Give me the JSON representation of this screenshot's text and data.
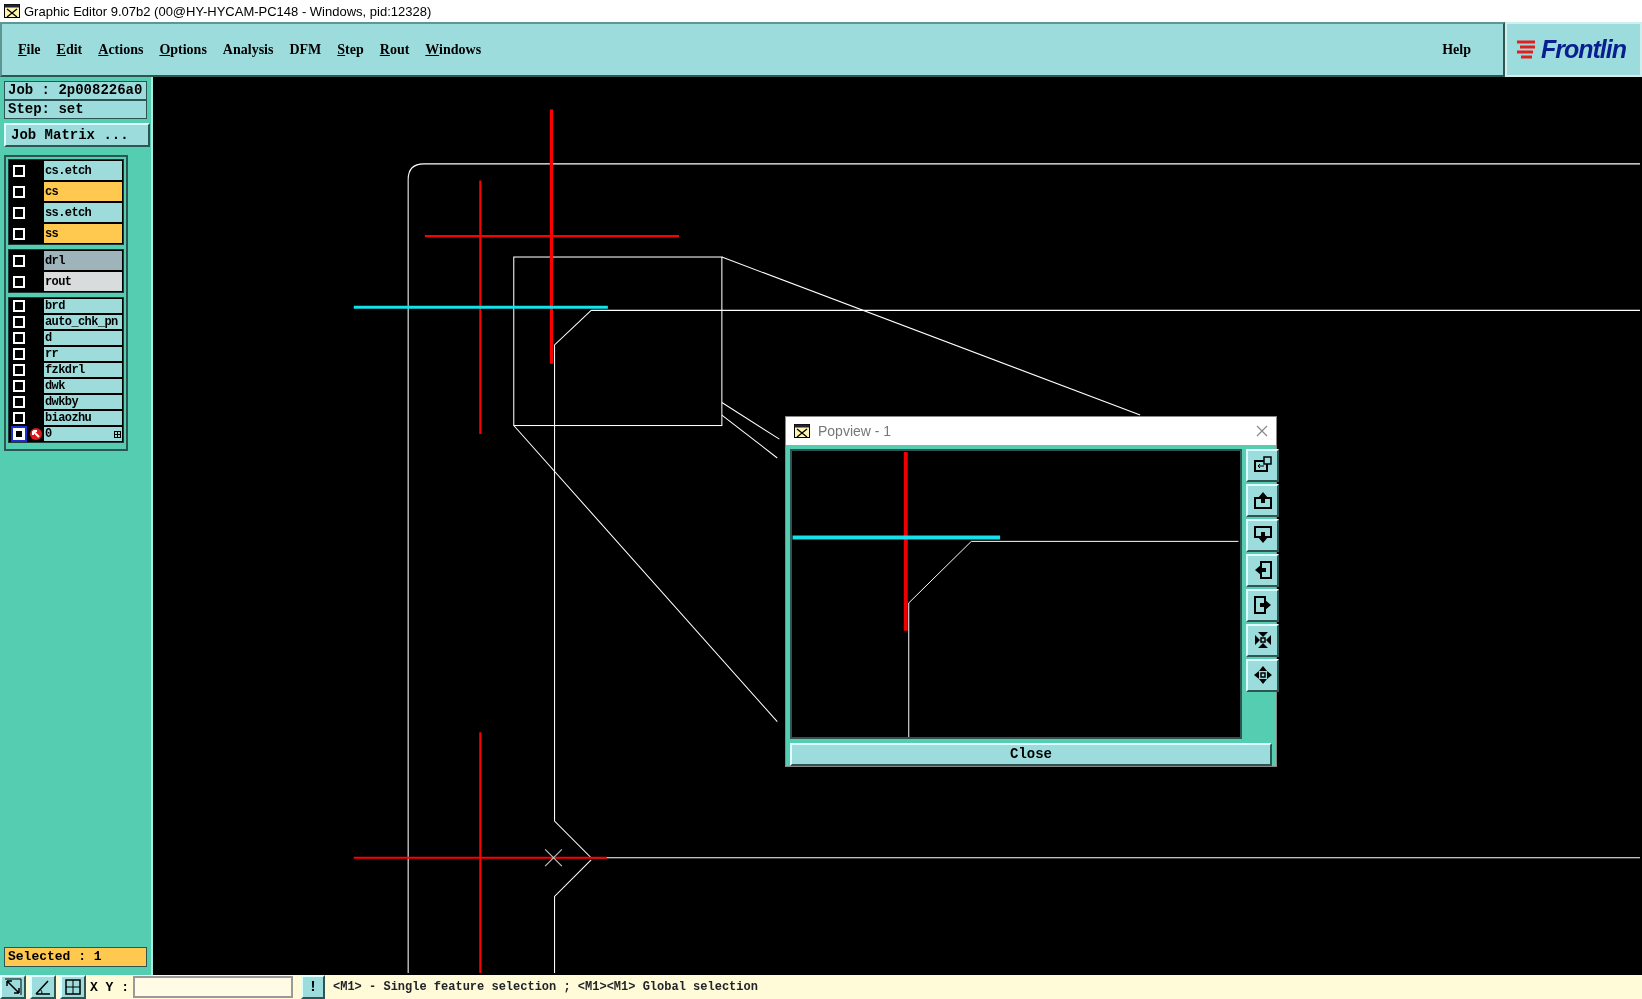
{
  "window": {
    "title": "Graphic Editor 9.07b2 (00@HY-HYCAM-PC148 - Windows, pid:12328)"
  },
  "menu": [
    {
      "label": "File",
      "mnemonic": true
    },
    {
      "label": "Edit",
      "mnemonic": true
    },
    {
      "label": "Actions",
      "mnemonic": true
    },
    {
      "label": "Options",
      "mnemonic": true
    },
    {
      "label": "Analysis",
      "mnemonic": false
    },
    {
      "label": "DFM",
      "mnemonic": false
    },
    {
      "label": "Step",
      "mnemonic": true
    },
    {
      "label": "Rout",
      "mnemonic": true
    },
    {
      "label": "Windows",
      "mnemonic": true
    }
  ],
  "help": "Help",
  "logo": "Frontlin",
  "panel": {
    "job": "Job : 2p008226a0",
    "step": "Step: set",
    "matrix_button": "Job Matrix ...",
    "layer_groups": [
      {
        "layers": [
          {
            "name": "cs.etch",
            "color": "#9edcdc",
            "checked": false,
            "work": false
          },
          {
            "name": "cs",
            "color": "#ffc84f",
            "checked": false,
            "work": false
          },
          {
            "name": "ss.etch",
            "color": "#9edcdc",
            "checked": false,
            "work": false
          },
          {
            "name": "ss",
            "color": "#ffc84f",
            "checked": false,
            "work": false
          }
        ]
      },
      {
        "layers": [
          {
            "name": "drl",
            "color": "#9fb4ba",
            "checked": false,
            "work": false
          },
          {
            "name": "rout",
            "color": "#d9dcdc",
            "checked": false,
            "work": false
          }
        ]
      },
      {
        "layers": [
          {
            "name": "brd",
            "color": "#9edcdc",
            "checked": false,
            "work": false
          },
          {
            "name": "auto_chk_pn",
            "color": "#9edcdc",
            "checked": false,
            "work": false
          },
          {
            "name": "d",
            "color": "#9edcdc",
            "checked": false,
            "work": false
          },
          {
            "name": "rr",
            "color": "#9edcdc",
            "checked": false,
            "work": false
          },
          {
            "name": "fzkdrl",
            "color": "#9edcdc",
            "checked": false,
            "work": false
          },
          {
            "name": "dwk",
            "color": "#9edcdc",
            "checked": false,
            "work": false
          },
          {
            "name": "dwkby",
            "color": "#9edcdc",
            "checked": false,
            "work": false
          },
          {
            "name": "biaozhu",
            "color": "#9edcdc",
            "checked": false,
            "work": false
          },
          {
            "name": "0",
            "color": "#9edcdc",
            "checked": false,
            "work": true
          }
        ]
      }
    ],
    "selected": "Selected : 1"
  },
  "popview": {
    "title": "Popview - 1",
    "close_button": "Close"
  },
  "status_bar": {
    "xy_label": "X Y :",
    "alert_button": "!",
    "message": "<M1> - Single feature selection ; <M1><M1> Global selection"
  }
}
